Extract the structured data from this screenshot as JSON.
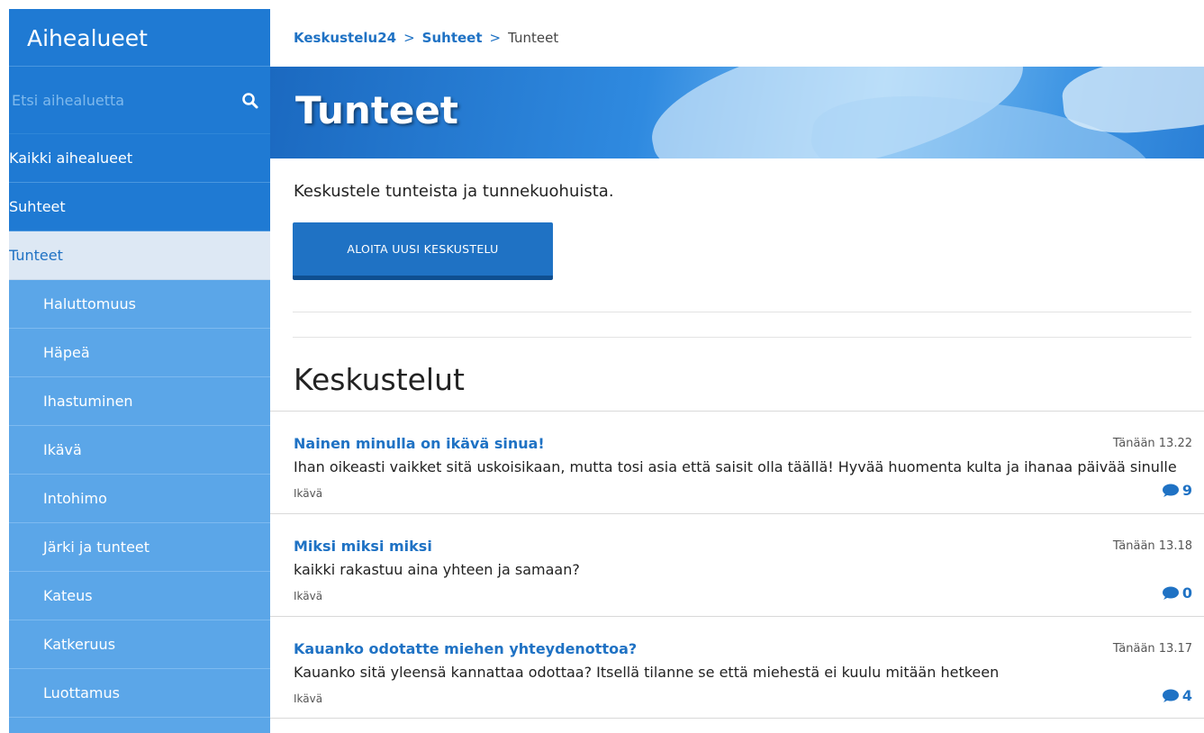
{
  "sidebar": {
    "title": "Aihealueet",
    "search_placeholder": "Etsi aihealuetta",
    "search_icon": "search-icon",
    "top_items": [
      {
        "label": "Kaikki aihealueet"
      },
      {
        "label": "Suhteet"
      }
    ],
    "active_item": {
      "label": "Tunteet"
    },
    "sub_items": [
      {
        "label": "Haluttomuus"
      },
      {
        "label": "Häpeä"
      },
      {
        "label": "Ihastuminen"
      },
      {
        "label": "Ikävä"
      },
      {
        "label": "Intohimo"
      },
      {
        "label": "Järki ja tunteet"
      },
      {
        "label": "Kateus"
      },
      {
        "label": "Katkeruus"
      },
      {
        "label": "Luottamus"
      }
    ]
  },
  "breadcrumb": {
    "items": [
      "Keskustelu24",
      "Suhteet"
    ],
    "separator": ">",
    "current": "Tunteet"
  },
  "hero": {
    "title": "Tunteet"
  },
  "description": "Keskustele tunteista ja tunnekuohuista.",
  "new_discussion_button": "ALOITA UUSI KESKUSTELU",
  "discussions_title": "Keskustelut",
  "discussions": [
    {
      "title": "Nainen minulla on ikävä sinua!",
      "time": "Tänään 13.22",
      "excerpt": "Ihan oikeasti vaikket sitä uskoisikaan, mutta tosi asia että saisit olla täällä! Hyvää huomenta kulta ja ihanaa päivää sinulle",
      "tag": "Ikävä",
      "comments": "9"
    },
    {
      "title": "Miksi miksi miksi",
      "time": "Tänään 13.18",
      "excerpt": "kaikki rakastuu aina yhteen ja samaan?",
      "tag": "Ikävä",
      "comments": "0"
    },
    {
      "title": "Kauanko odotatte miehen yhteydenottoa?",
      "time": "Tänään 13.17",
      "excerpt": "Kauanko sitä yleensä kannattaa odottaa? Itsellä tilanne se että miehestä ei kuulu mitään hetkeen",
      "tag": "Ikävä",
      "comments": "4"
    }
  ],
  "colors": {
    "primary": "#1f72c4",
    "sidebar_dark": "#1f7ad3",
    "sidebar_light": "#5ba6e8",
    "active_bg": "#dde8f4"
  }
}
